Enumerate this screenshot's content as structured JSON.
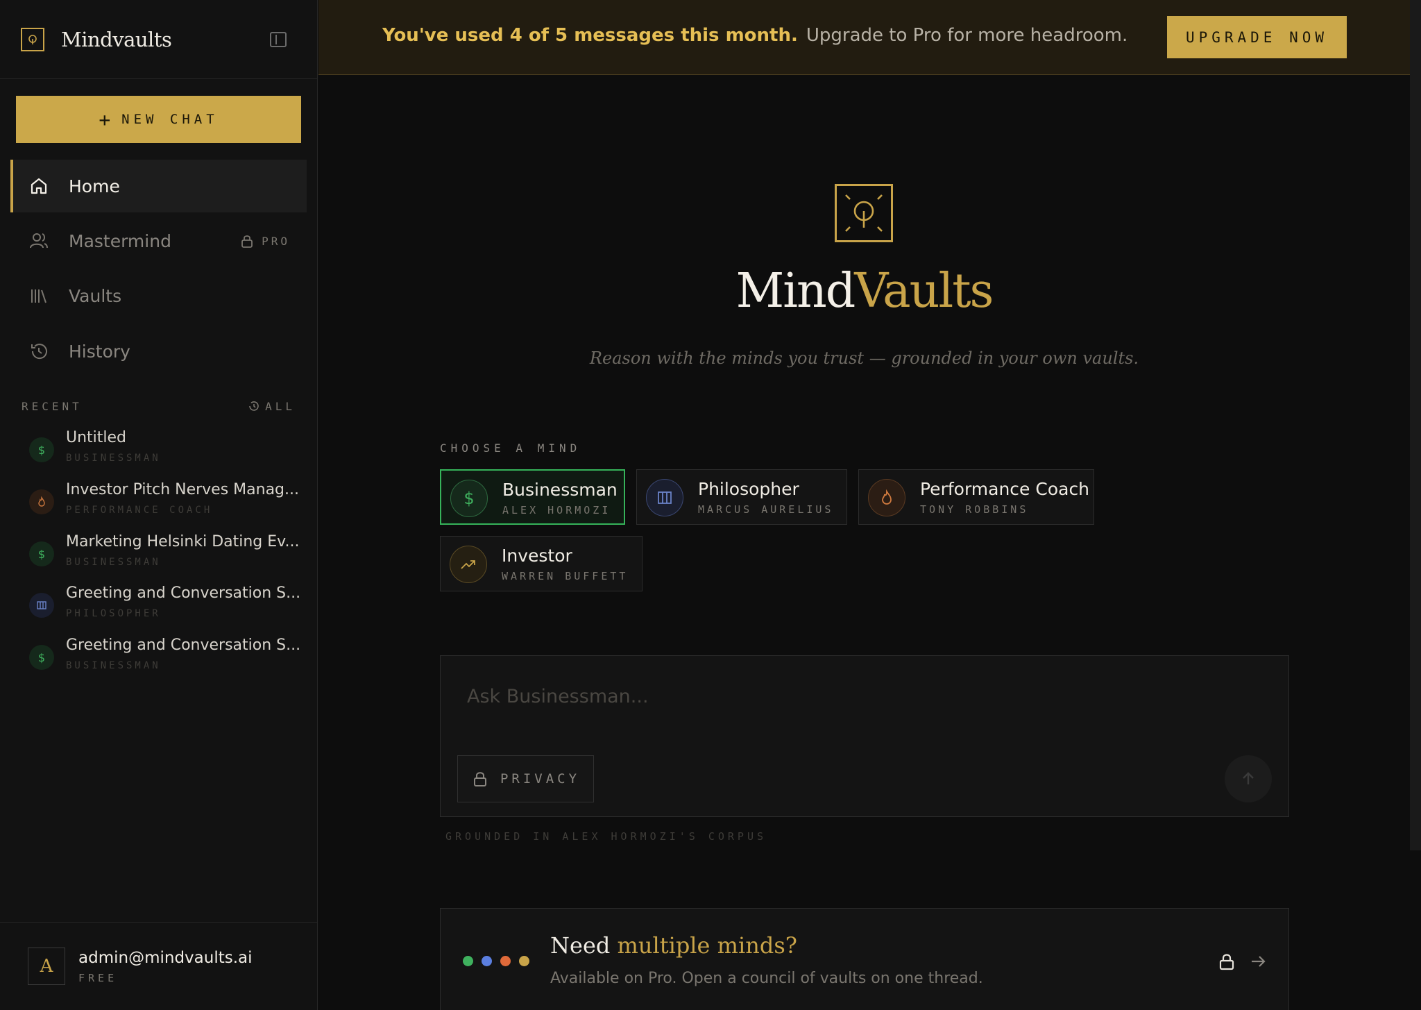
{
  "sidebar": {
    "brand": "Mindvaults",
    "new_chat_label": "NEW CHAT",
    "nav": [
      {
        "label": "Home",
        "icon": "home-icon",
        "active": true
      },
      {
        "label": "Mastermind",
        "icon": "users-icon",
        "badge": "PRO"
      },
      {
        "label": "Vaults",
        "icon": "library-icon"
      },
      {
        "label": "History",
        "icon": "history-icon"
      }
    ],
    "recent_label": "RECENT",
    "recent_all_label": "ALL",
    "recent": [
      {
        "title": "Untitled",
        "mind": "BUSINESSMAN",
        "icon": "dollar-icon"
      },
      {
        "title": "Investor Pitch Nerves Manag...",
        "mind": "PERFORMANCE COACH",
        "icon": "flame-icon"
      },
      {
        "title": "Marketing Helsinki Dating Ev...",
        "mind": "BUSINESSMAN",
        "icon": "dollar-icon"
      },
      {
        "title": "Greeting and Conversation S...",
        "mind": "PHILOSOPHER",
        "icon": "columns-icon"
      },
      {
        "title": "Greeting and Conversation S...",
        "mind": "BUSINESSMAN",
        "icon": "dollar-icon"
      }
    ],
    "account": {
      "initial": "A",
      "email": "admin@mindvaults.ai",
      "plan": "FREE"
    }
  },
  "banner": {
    "strong": "You've used 4 of 5 messages this month.",
    "weak": "Upgrade to Pro for more headroom.",
    "button": "UPGRADE NOW"
  },
  "hero": {
    "title_a": "Mind",
    "title_b": "Vaults",
    "subtitle": "Reason with the minds you trust — grounded in your own vaults."
  },
  "minds": {
    "label": "CHOOSE A MIND",
    "items": [
      {
        "name": "Businessman",
        "person": "ALEX HORMOZI",
        "glyph": "$",
        "active": true
      },
      {
        "name": "Philosopher",
        "person": "MARCUS AURELIUS",
        "glyph": ""
      },
      {
        "name": "Performance Coach",
        "person": "TONY ROBBINS",
        "glyph": ""
      },
      {
        "name": "Investor",
        "person": "WARREN BUFFETT",
        "glyph": ""
      }
    ]
  },
  "composer": {
    "placeholder": "Ask Businessman...",
    "privacy_label": "PRIVACY",
    "grounded": "GROUNDED IN ALEX HORMOZI'S CORPUS"
  },
  "promo": {
    "title_a": "Need ",
    "title_b": "multiple minds?",
    "subtitle": "Available on Pro. Open a council of vaults on one thread.",
    "dot_colors": [
      "#3fb15e",
      "#5b7fe0",
      "#e06a3a",
      "#c9a449"
    ]
  },
  "colors": {
    "accent": "#c9a449",
    "active_green": "#36b35a",
    "background": "#0d0d0d"
  }
}
